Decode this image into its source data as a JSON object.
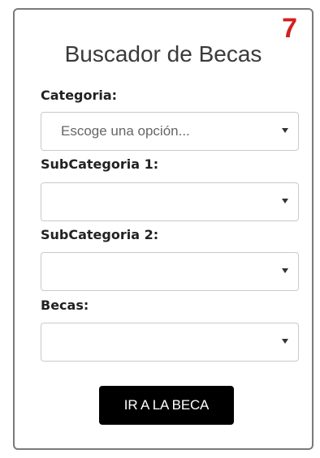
{
  "widget": {
    "number_badge": "7",
    "title": "Buscador de Becas"
  },
  "fields": [
    {
      "label": "Categoria:",
      "value": "Escoge una opción..."
    },
    {
      "label": "SubCategoria 1:",
      "value": ""
    },
    {
      "label": "SubCategoria 2:",
      "value": ""
    },
    {
      "label": "Becas:",
      "value": ""
    }
  ],
  "actions": {
    "go_button_label": "IR A LA BECA"
  },
  "colors": {
    "badge": "#d32020",
    "button_bg": "#000000",
    "button_text": "#ffffff",
    "border": "#7a7a7a"
  },
  "icons": {
    "select_caret": "caret-down-icon"
  }
}
